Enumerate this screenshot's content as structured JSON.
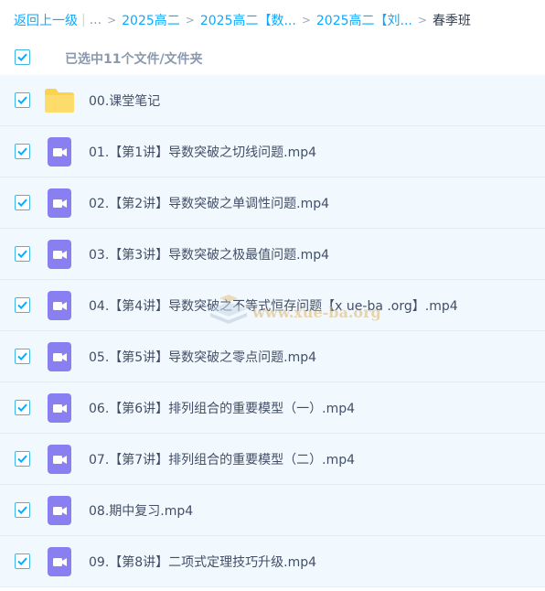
{
  "breadcrumb": {
    "back_label": "返回上一级",
    "separator": "|",
    "ellipsis": "...",
    "arrow": ">",
    "items": [
      {
        "label": "2025高二"
      },
      {
        "label": "2025高二【数..."
      },
      {
        "label": "2025高二【刘..."
      }
    ],
    "current": "春季班"
  },
  "selection": {
    "label": "已选中11个文件/文件夹",
    "checked": true
  },
  "files": [
    {
      "name": "00.课堂笔记",
      "type": "folder",
      "checked": true
    },
    {
      "name": "01.【第1讲】导数突破之切线问题.mp4",
      "type": "video",
      "checked": true
    },
    {
      "name": "02.【第2讲】导数突破之单调性问题.mp4",
      "type": "video",
      "checked": true
    },
    {
      "name": "03.【第3讲】导数突破之极最值问题.mp4",
      "type": "video",
      "checked": true
    },
    {
      "name": "04.【第4讲】导数突破之不等式恒存问题【x ue-ba .org】.mp4",
      "type": "video",
      "checked": true
    },
    {
      "name": "05.【第5讲】导数突破之零点问题.mp4",
      "type": "video",
      "checked": true
    },
    {
      "name": "06.【第6讲】排列组合的重要模型（一）.mp4",
      "type": "video",
      "checked": true
    },
    {
      "name": "07.【第7讲】排列组合的重要模型（二）.mp4",
      "type": "video",
      "checked": true
    },
    {
      "name": "08.期中复习.mp4",
      "type": "video",
      "checked": true
    },
    {
      "name": "09.【第8讲】二项式定理技巧升级.mp4",
      "type": "video",
      "checked": true
    }
  ],
  "watermark": {
    "text": "www.xue-ba.org"
  },
  "colors": {
    "link": "#09aaff",
    "checkbox_border": "#3fb5e8",
    "check_mark": "#09aaff",
    "row_bg": "#f2f9fe",
    "video_icon": "#8a7ff0",
    "folder_icon": "#fcd34d"
  }
}
